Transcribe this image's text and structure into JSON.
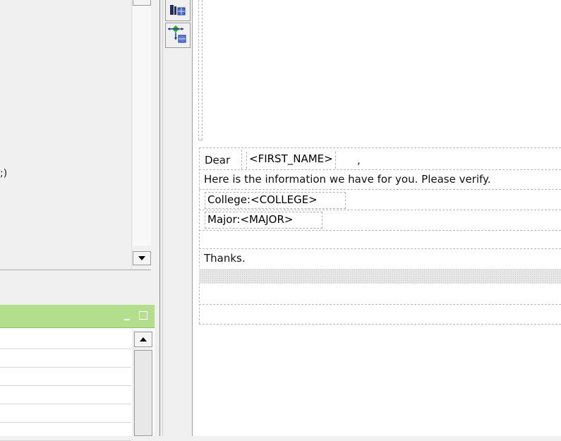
{
  "left_pane": {
    "partial_text": ";)"
  },
  "panel": {
    "row_count": 6
  },
  "toolbar": {
    "buttons": [
      {
        "icon": "table-insert-icon"
      },
      {
        "icon": "field-move-icon"
      }
    ]
  },
  "letter": {
    "greeting": "Dear",
    "first_name_field": "<FIRST_NAME>",
    "greeting_comma": ",",
    "intro": "Here is the information we have for you.  Please verify.",
    "college_label": "College:",
    "college_field": "<COLLEGE>",
    "major_label": "Major:",
    "major_field": "<MAJOR>",
    "closing": "Thanks."
  }
}
